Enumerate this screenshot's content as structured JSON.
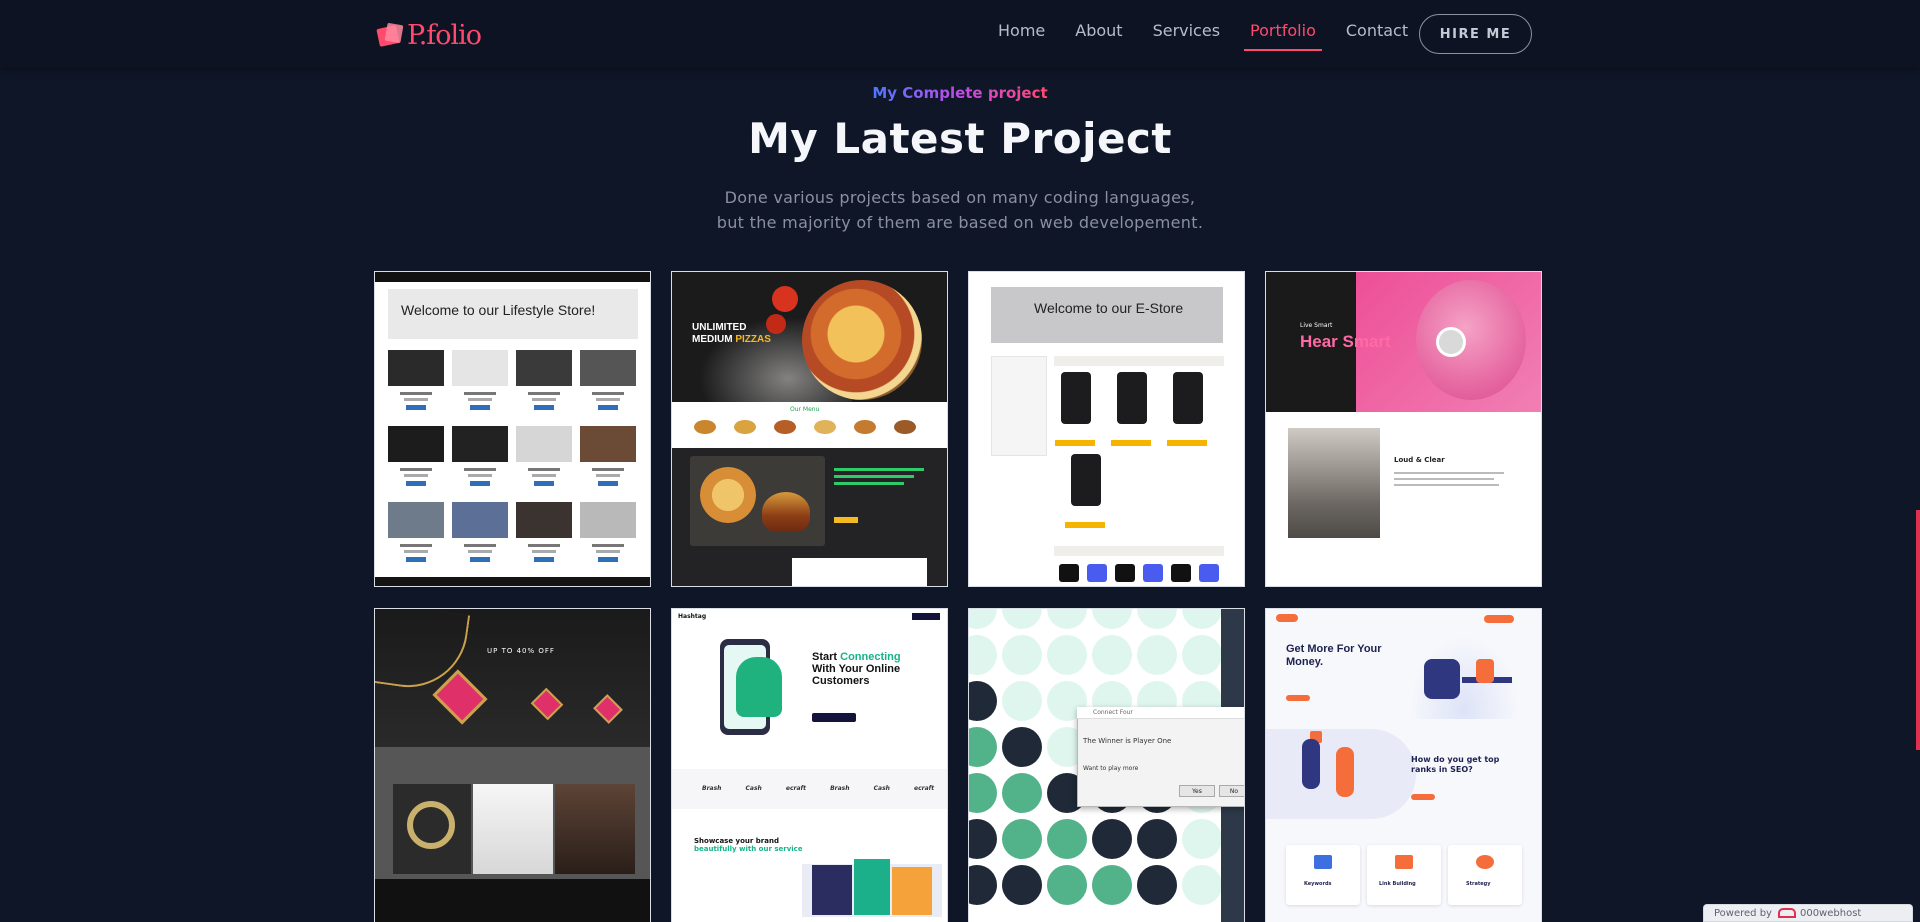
{
  "nav": {
    "logo": "P.folio",
    "items": [
      {
        "label": "Home",
        "active": false
      },
      {
        "label": "About",
        "active": false
      },
      {
        "label": "Services",
        "active": false
      },
      {
        "label": "Portfolio",
        "active": true
      },
      {
        "label": "Contact",
        "active": false
      }
    ],
    "hire_label": "HIRE ME"
  },
  "section": {
    "eyebrow": "My Complete project",
    "title": "My Latest Project",
    "subtitle_line1": "Done various projects based on many coding languages,",
    "subtitle_line2": "but the majority of them are based on web developement."
  },
  "projects": [
    {
      "hero_text": "Welcome to our Lifestyle Store!"
    },
    {
      "line1": "UNLIMITED",
      "line2_prefix": "MEDIUM ",
      "line2_highlight": "PIZZAS",
      "menu_title": "Our Menu"
    },
    {
      "hero_text": "Welcome to our E-Store"
    },
    {
      "kicker": "Live Smart",
      "headline": "Hear Smart",
      "section_label": "Loud & Clear"
    },
    {
      "offer": "UP TO 40% OFF"
    },
    {
      "brand": "Hashtag",
      "headline_prefix": "Start ",
      "headline_highlight": "Connecting",
      "headline_rest": "With Your Online Customers",
      "logos": "Brash Cash ecraft Brash Cash ecraft",
      "sub_prefix": "Showcase your brand ",
      "sub_highlight": "beautifully with our services"
    },
    {
      "dialog_title": "Connect Four",
      "winner_text": "The Winner is Player One",
      "prompt_text": "Want to play more",
      "yes_label": "Yes",
      "no_label": "No"
    },
    {
      "headline": "Get More For Your Money.",
      "sub": "How do you get top ranks in SEO?",
      "boxes": [
        "Keywords",
        "Link Building",
        "Strategy"
      ]
    }
  ],
  "badge": {
    "prefix": "Powered by",
    "brand": "000webhost"
  },
  "colors": {
    "accent": "#ff4a6e",
    "background": "#0f1627",
    "nav_bg": "#0d1322"
  }
}
